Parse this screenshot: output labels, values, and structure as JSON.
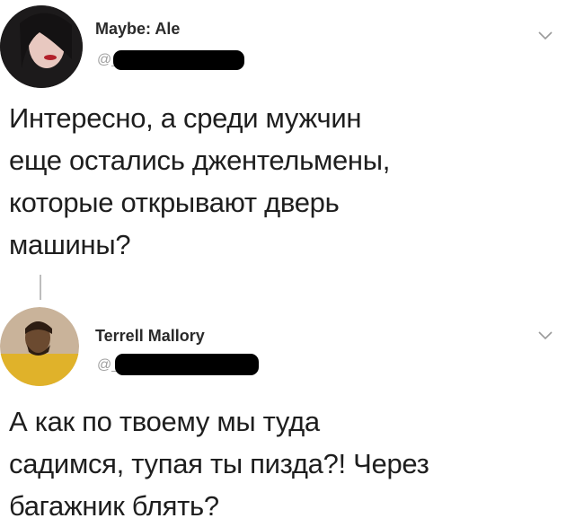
{
  "tweets": [
    {
      "author_name": "Maybe: Ale",
      "handle": "@_",
      "text": "Интересно, а среди мужчин\nеще остались джентельмены,\nкоторые открывают дверь\nмашины?"
    },
    {
      "author_name": "Terrell Mallory",
      "handle": "@_",
      "text": "А как по твоему мы туда\nсадимся, тупая ты пизда?! Через\nбагажник блять?"
    }
  ],
  "icons": {
    "menu": "chevron-down-icon"
  },
  "colors": {
    "text": "#1e1e1e",
    "muted": "#a0a0a0",
    "redaction": "#000000"
  }
}
